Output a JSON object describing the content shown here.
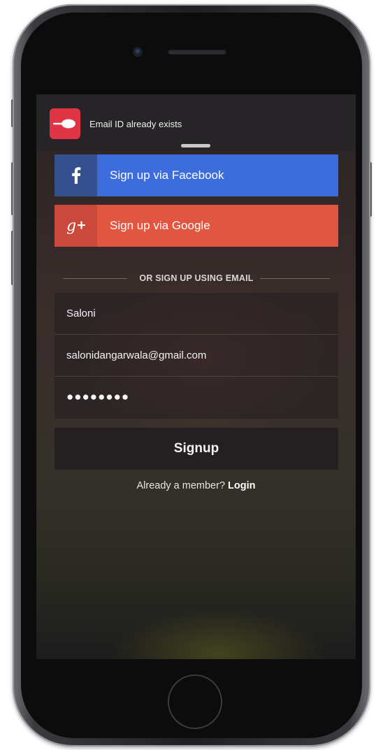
{
  "notification": {
    "message": "Email ID already exists",
    "app_icon": "spoon-icon",
    "icon_color": "#e03444"
  },
  "social": {
    "facebook_label": "Sign up via Facebook",
    "facebook_color": "#3d6cdd",
    "google_label": "Sign up via Google",
    "google_color": "#e25540"
  },
  "divider_text": "OR SIGN UP USING EMAIL",
  "form": {
    "name_value": "Saloni",
    "email_value": "salonidangarwala@gmail.com",
    "password_value": "●●●●●●●●"
  },
  "signup_label": "Signup",
  "login": {
    "prompt": "Already a member?",
    "link": "Login"
  }
}
